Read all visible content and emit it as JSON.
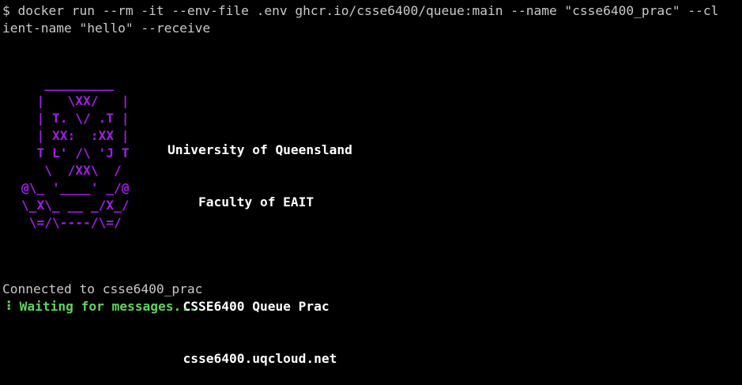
{
  "terminal": {
    "command_line_1": "$ docker run --rm -it --env-file .env ghcr.io/csse6400/queue:main --name \"csse6400_prac\" --cl",
    "command_line_2": "ient-name \"hello\" --receive",
    "logo_lines": [
      "   _________",
      "  |   \\XX/   |",
      "  | T. \\/ .T |",
      "  | XX:  :XX |",
      "  T L' /\\ 'J T",
      "   \\  /XX\\  /",
      "@\\_ '____' _/@",
      "\\_X\\_ __ _/X_/",
      " \\=/\\----/\\=/"
    ],
    "info_lines": [
      "University of Queensland",
      "    Faculty of EAIT",
      "",
      "  CSSE6400 Queue Prac",
      "  csse6400.uqcloud.net"
    ],
    "connected_text": "Connected to csse6400_prac",
    "spinner_char": "⠸",
    "waiting_text": "Waiting for messages..."
  },
  "colors": {
    "background": "#000000",
    "text": "#c9c9c9",
    "logo": "#a21fe6",
    "info": "#ffffff",
    "waiting": "#5fd35f"
  }
}
